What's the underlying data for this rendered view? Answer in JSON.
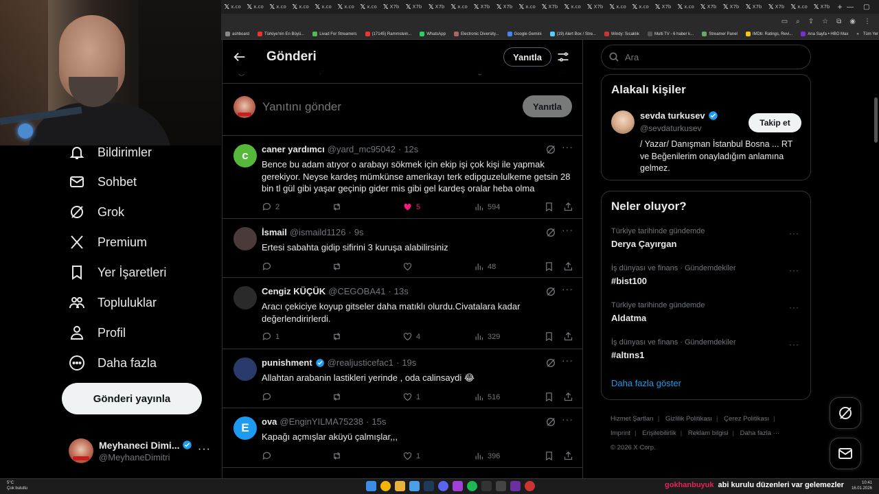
{
  "browser": {
    "tabs": [
      "x.co",
      "x.co",
      "x.co",
      "x.co",
      "x.co",
      "x.co",
      "x.co",
      "X7b",
      "X7b",
      "X7b",
      "x.co",
      "X7b",
      "X7b",
      "x.co",
      "X7b",
      "x.co",
      "X7b",
      "x.co",
      "x.co",
      "X7b",
      "x.co",
      "X7b",
      "X7b",
      "X7b",
      "X7b",
      "x.co",
      "X7b"
    ],
    "new_tab": "+",
    "bookmarks": [
      "ashboard",
      "Türkiye'nin En Büyü...",
      "Livad For Streamers",
      "(17145) Rammstein...",
      "WhatsApp",
      "Electronic Diversity...",
      "Google Gemini",
      "(19) Alert Box / Stre...",
      "Windy: Sıcaklık",
      "Multi TV - 6 haber k...",
      "Streamer Panel",
      "IMDb: Ratings, Revi...",
      "Ana Sayfa • HBO Max"
    ],
    "bookmarks_more": "»",
    "all_bookmarks": "Tüm Yer İşaretleri"
  },
  "sidebar": {
    "items": [
      {
        "label": "Bildirimler",
        "icon": "bell-icon"
      },
      {
        "label": "Sohbet",
        "icon": "mail-icon"
      },
      {
        "label": "Grok",
        "icon": "grok-icon"
      },
      {
        "label": "Premium",
        "icon": "x-logo-icon"
      },
      {
        "label": "Yer İşaretleri",
        "icon": "bookmark-icon"
      },
      {
        "label": "Topluluklar",
        "icon": "people-icon"
      },
      {
        "label": "Profil",
        "icon": "person-icon"
      },
      {
        "label": "Daha fazla",
        "icon": "more-circle-icon"
      }
    ],
    "post_button": "Gönderi yayınla",
    "account": {
      "name": "Meyhaneci Dimi...",
      "handle": "@MeyhaneDimitri",
      "more": "···"
    }
  },
  "main": {
    "title": "Gönderi",
    "reply_button": "Yanıtla",
    "compose": {
      "placeholder": "Yanıtını gönder",
      "button": "Yanıtla"
    },
    "replies": [
      {
        "name": "caner yardımcı",
        "handle": "@yard_mc95042",
        "time": "12s",
        "verified": false,
        "avatar_letter": "c",
        "avatar_color": "#56b83a",
        "text": "Bence bu adam atıyor o arabayı sökmek için ekip işi çok kişi ile yapmak gerekiyor. Neyse kardeş mümkünse amerikayı terk  edipguzelulkeme getsin 28 bin tl gül gibi yaşar geçinip gider mis gibi gel kardeş oralar heba olma",
        "replies": "2",
        "reposts": "",
        "likes": "5",
        "liked": true,
        "views": "594"
      },
      {
        "name": "İsmail",
        "handle": "@ismaild1126",
        "time": "9s",
        "verified": false,
        "avatar_letter": "",
        "avatar_color": "#4a3a3a",
        "text": "Ertesi sabahta gidip sifirini 3 kuruşa alabilirsiniz",
        "replies": "",
        "reposts": "",
        "likes": "",
        "liked": false,
        "views": "48"
      },
      {
        "name": "Cengiz KÜÇÜK",
        "handle": "@CEGOBA41",
        "time": "13s",
        "verified": false,
        "avatar_letter": "",
        "avatar_color": "#2a2a2a",
        "text": "Aracı çekiciye koyup gitseler daha matıklı olurdu.Civatalara kadar değerlendirirlerdi.",
        "replies": "1",
        "reposts": "",
        "likes": "4",
        "liked": false,
        "views": "329"
      },
      {
        "name": "punishment",
        "handle": "@realjusticefac1",
        "time": "19s",
        "verified": true,
        "avatar_letter": "",
        "avatar_color": "#2a3a6a",
        "text": "Allahtan arabanin lastikleri yerinde , oda calinsaydi 😂",
        "replies": "",
        "reposts": "",
        "likes": "1",
        "liked": false,
        "views": "516"
      },
      {
        "name": "ova",
        "handle": "@EnginYILMA75238",
        "time": "15s",
        "verified": false,
        "avatar_letter": "E",
        "avatar_color": "#1d9bf0",
        "text": "Kapağı açmışlar aküyü çalmışlar,,,",
        "replies": "",
        "reposts": "",
        "likes": "1",
        "liked": false,
        "views": "396"
      }
    ]
  },
  "right": {
    "search_placeholder": "Ara",
    "related": {
      "title": "Alakalı kişiler",
      "name": "sevda turkusev",
      "handle": "@sevdaturkusev",
      "follow": "Takip et",
      "bio": "/ Yazar/ Danışman İstanbul Bosna ... RT ve Beğenilerim onayladığım anlamına gelmez."
    },
    "trends": {
      "title": "Neler oluyor?",
      "items": [
        {
          "category": "Türkiye tarihinde gündemde",
          "name": "Derya Çayırgan"
        },
        {
          "category": "İş dünyası ve finans · Gündemdekiler",
          "name": "#bist100"
        },
        {
          "category": "Türkiye tarihinde gündemde",
          "name": "Aldatma"
        },
        {
          "category": "İş dünyası ve finans · Gündemdekiler",
          "name": "#altıns1"
        }
      ],
      "show_more": "Daha fazla göster"
    },
    "footer": [
      "Hizmet Şartları",
      "Gizlilik Politikası",
      "Çerez Politikası",
      "Imprint",
      "Erişilebilirlik",
      "Reklam bilgisi",
      "Daha fazla ···",
      "© 2026 X Corp."
    ]
  },
  "taskbar": {
    "temp": "5°C",
    "weather": "Çok bulutlu",
    "ticker_user": "gokhanbuyuk",
    "ticker_msg": "abi kurulu düzenleri var gelemezler",
    "time": "10:41",
    "date": "16.01.2026"
  },
  "colors": {
    "accent": "#1d9bf0",
    "like": "#f91880",
    "background": "#000000",
    "border": "#2f3336",
    "muted": "#71767b"
  }
}
